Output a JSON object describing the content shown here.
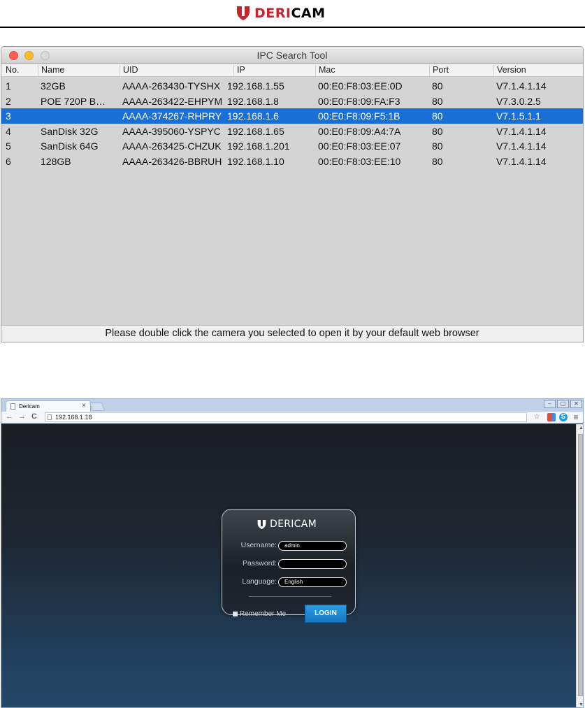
{
  "doc_header": {
    "brand_prefix": "DERI",
    "brand_suffix": "CAM",
    "brand_colors": {
      "prefix": "#c8242b",
      "suffix": "#000000",
      "shield": "#c8242b"
    }
  },
  "ipc_tool": {
    "title": "IPC Search Tool",
    "columns": [
      "No.",
      "Name",
      "UID",
      "IP",
      "Mac",
      "Port",
      "Version"
    ],
    "rows": [
      {
        "no": "1",
        "name": "32GB",
        "uid": "AAAA-263430-TYSHX",
        "ip": "192.168.1.55",
        "mac": "00:E0:F8:03:EE:0D",
        "port": "80",
        "version": "V7.1.4.1.14"
      },
      {
        "no": "2",
        "name": "POE 720P B…",
        "uid": "AAAA-263422-EHPYM",
        "ip": "192.168.1.8",
        "mac": "00:E0:F8:09:FA:F3",
        "port": "80",
        "version": "V7.3.0.2.5"
      },
      {
        "no": "3",
        "name": "",
        "uid": "AAAA-374267-RHPRY",
        "ip": "192.168.1.6",
        "mac": "00:E0:F8:09:F5:1B",
        "port": "80",
        "version": "V7.1.5.1.1"
      },
      {
        "no": "4",
        "name": "SanDisk 32G",
        "uid": "AAAA-395060-YSPYC",
        "ip": "192.168.1.65",
        "mac": "00:E0:F8:09:A4:7A",
        "port": "80",
        "version": "V7.1.4.1.14"
      },
      {
        "no": "5",
        "name": "SanDisk 64G",
        "uid": "AAAA-263425-CHZUK",
        "ip": "192.168.1.201",
        "mac": "00:E0:F8:03:EE:07",
        "port": "80",
        "version": "V7.1.4.1.14"
      },
      {
        "no": "6",
        "name": "128GB",
        "uid": "AAAA-263426-BBRUH",
        "ip": "192.168.1.10",
        "mac": "00:E0:F8:03:EE:10",
        "port": "80",
        "version": "V7.1.4.1.14"
      }
    ],
    "selected_row": "3",
    "status_text": "Please double click the camera you selected to open it by your default web browser"
  },
  "browser": {
    "tab_title": "Dericam",
    "tab_close": "×",
    "window_controls": [
      "–",
      "▢",
      "✕"
    ],
    "nav": {
      "back": "←",
      "forward": "→",
      "reload": "C"
    },
    "url": "192.168.1.18",
    "toolbar_icons": [
      "star-icon",
      "extension-icon",
      "skype-icon",
      "menu-icon"
    ],
    "toolbar_glyphs": {
      "star": "☆",
      "menu": "≡",
      "skype": "S"
    }
  },
  "login": {
    "brand": "DERICAM",
    "username_label": "Username:",
    "username_value": "admin",
    "password_label": "Password:",
    "password_value": "",
    "language_label": "Language:",
    "language_value": "English",
    "remember_label": "Remember Me",
    "login_button": "LOGIN",
    "button_color": "#1a86cf"
  }
}
